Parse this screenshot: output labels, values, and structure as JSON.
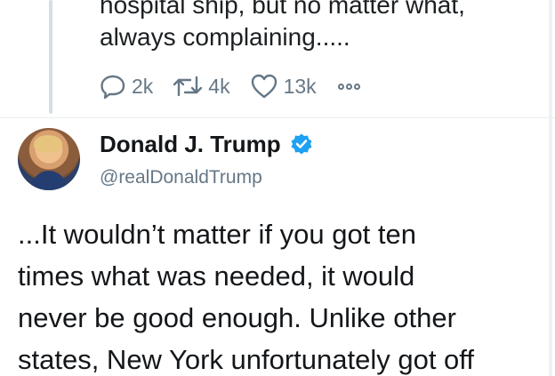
{
  "previous_tweet": {
    "text": "hospital ship, but no matter what,\nalways complaining.....",
    "reply_count": "2k",
    "retweet_count": "4k",
    "like_count": "13k"
  },
  "tweet": {
    "display_name": "Donald J. Trump",
    "handle": "@realDonaldTrump",
    "text": "...It wouldn’t matter if you got ten\ntimes what was needed, it would\nnever be good enough. Unlike other\nstates, New York unfortunately got off"
  },
  "icons": {
    "reply": "reply-icon",
    "retweet": "retweet-icon",
    "like": "heart-icon",
    "more": "more-icon",
    "verified": "verified-badge-icon"
  },
  "colors": {
    "text_primary": "#14171a",
    "text_secondary": "#657786",
    "verified_blue": "#1da1f2",
    "thread_line": "#d6dde3"
  }
}
